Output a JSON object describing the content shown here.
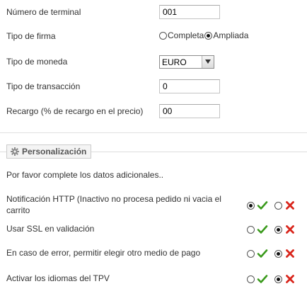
{
  "config": {
    "terminal_label": "Número de terminal",
    "terminal_value": "001",
    "firma_label": "Tipo de firma",
    "firma_options": [
      "Completa",
      "Ampliada"
    ],
    "firma_selected": "Ampliada",
    "moneda_label": "Tipo de moneda",
    "moneda_value": "EURO",
    "transaccion_label": "Tipo de transacción",
    "transaccion_value": "0",
    "recargo_label": "Recargo (% de recargo en el precio)",
    "recargo_value": "00"
  },
  "personalizacion": {
    "legend": "Personalización",
    "intro": "Por favor complete los datos adicionales..",
    "options": [
      {
        "label_line1": "Notificación HTTP (Inactivo no procesa pedido ni vacia el",
        "label_line2": "carrito",
        "selected": "yes"
      },
      {
        "label_line1": "Usar SSL en validación",
        "label_line2": "",
        "selected": "no"
      },
      {
        "label_line1": "En caso de error, permitir elegir otro medio de pago",
        "label_line2": "",
        "selected": "no"
      },
      {
        "label_line1": "Activar los idiomas del TPV",
        "label_line2": "",
        "selected": "no"
      }
    ]
  },
  "colors": {
    "check_green": "#3a9a1c",
    "cross_red": "#d9261c"
  },
  "icons": {
    "legend": "gear-icon",
    "yes": "checkmark-icon",
    "no": "cross-icon"
  }
}
